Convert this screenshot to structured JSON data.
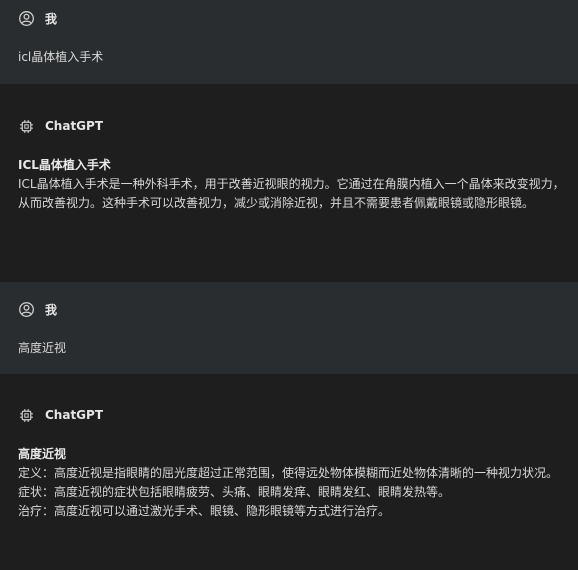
{
  "messages": [
    {
      "role": "user",
      "author": "我",
      "text": "icl晶体植入手术"
    },
    {
      "role": "assistant",
      "author": "ChatGPT",
      "title": "ICL晶体植入手术",
      "lines": [
        "ICL晶体植入手术是一种外科手术，用于改善近视眼的视力。它通过在角膜内植入一个晶体来改变视力，从而改善视力。这种手术可以改善视力，减少或消除近视，并且不需要患者佩戴眼镜或隐形眼镜。"
      ]
    },
    {
      "role": "user",
      "author": "我",
      "text": "高度近视"
    },
    {
      "role": "assistant",
      "author": "ChatGPT",
      "title": "高度近视",
      "lines": [
        "定义：高度近视是指眼睛的屈光度超过正常范围，使得远处物体模糊而近处物体清晰的一种视力状况。",
        "症状：高度近视的症状包括眼睛疲劳、头痛、眼睛发痒、眼睛发红、眼睛发热等。",
        "治疗：高度近视可以通过激光手术、眼镜、隐形眼镜等方式进行治疗。"
      ]
    }
  ]
}
